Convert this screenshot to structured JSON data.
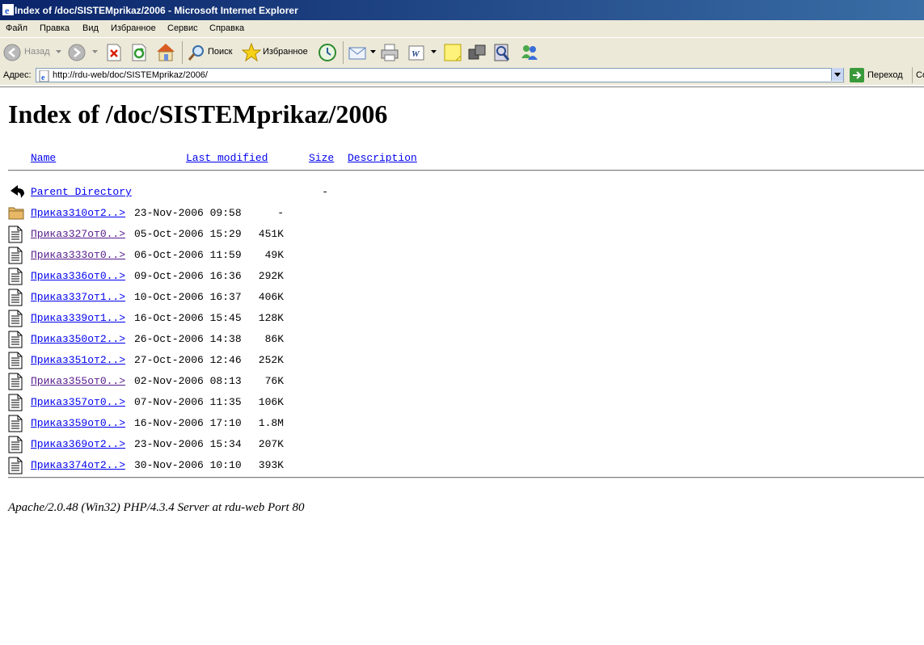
{
  "window": {
    "title": "Index of /doc/SISTEMprikaz/2006 - Microsoft Internet Explorer"
  },
  "menu": [
    "Файл",
    "Правка",
    "Вид",
    "Избранное",
    "Сервис",
    "Справка"
  ],
  "toolbar": {
    "back_label": "Назад",
    "search_label": "Поиск",
    "favorites_label": "Избранное"
  },
  "address": {
    "label": "Адрес:",
    "url": "http://rdu-web/doc/SISTEMprikaz/2006/",
    "go_label": "Переход",
    "links_label": "Со"
  },
  "page": {
    "heading": "Index of /doc/SISTEMprikaz/2006",
    "columns": {
      "name": "Name",
      "modified": "Last modified",
      "size": "Size",
      "description": "Description"
    },
    "parent": {
      "label": "Parent Directory",
      "size": "-"
    },
    "rows": [
      {
        "name": "Приказ310от2..>",
        "date": "23-Nov-2006 09:58",
        "size": "-",
        "type": "folder",
        "visited": false
      },
      {
        "name": "Приказ327от0..>",
        "date": "05-Oct-2006 15:29",
        "size": "451K",
        "type": "file",
        "visited": true
      },
      {
        "name": "Приказ333от0..>",
        "date": "06-Oct-2006 11:59",
        "size": "49K",
        "type": "file",
        "visited": true
      },
      {
        "name": "Приказ336от0..>",
        "date": "09-Oct-2006 16:36",
        "size": "292K",
        "type": "file",
        "visited": false
      },
      {
        "name": "Приказ337от1..>",
        "date": "10-Oct-2006 16:37",
        "size": "406K",
        "type": "file",
        "visited": false
      },
      {
        "name": "Приказ339от1..>",
        "date": "16-Oct-2006 15:45",
        "size": "128K",
        "type": "file",
        "visited": false
      },
      {
        "name": "Приказ350от2..>",
        "date": "26-Oct-2006 14:38",
        "size": "86K",
        "type": "file",
        "visited": false
      },
      {
        "name": "Приказ351от2..>",
        "date": "27-Oct-2006 12:46",
        "size": "252K",
        "type": "file",
        "visited": false
      },
      {
        "name": "Приказ355от0..>",
        "date": "02-Nov-2006 08:13",
        "size": "76K",
        "type": "file",
        "visited": true
      },
      {
        "name": "Приказ357от0..>",
        "date": "07-Nov-2006 11:35",
        "size": "106K",
        "type": "file",
        "visited": false
      },
      {
        "name": "Приказ359от0..>",
        "date": "16-Nov-2006 17:10",
        "size": "1.8M",
        "type": "file",
        "visited": false
      },
      {
        "name": "Приказ369от2..>",
        "date": "23-Nov-2006 15:34",
        "size": "207K",
        "type": "file",
        "visited": false
      },
      {
        "name": "Приказ374от2..>",
        "date": "30-Nov-2006 10:10",
        "size": "393K",
        "type": "file",
        "visited": false
      }
    ],
    "footer": "Apache/2.0.48 (Win32) PHP/4.3.4 Server at rdu-web Port 80"
  }
}
